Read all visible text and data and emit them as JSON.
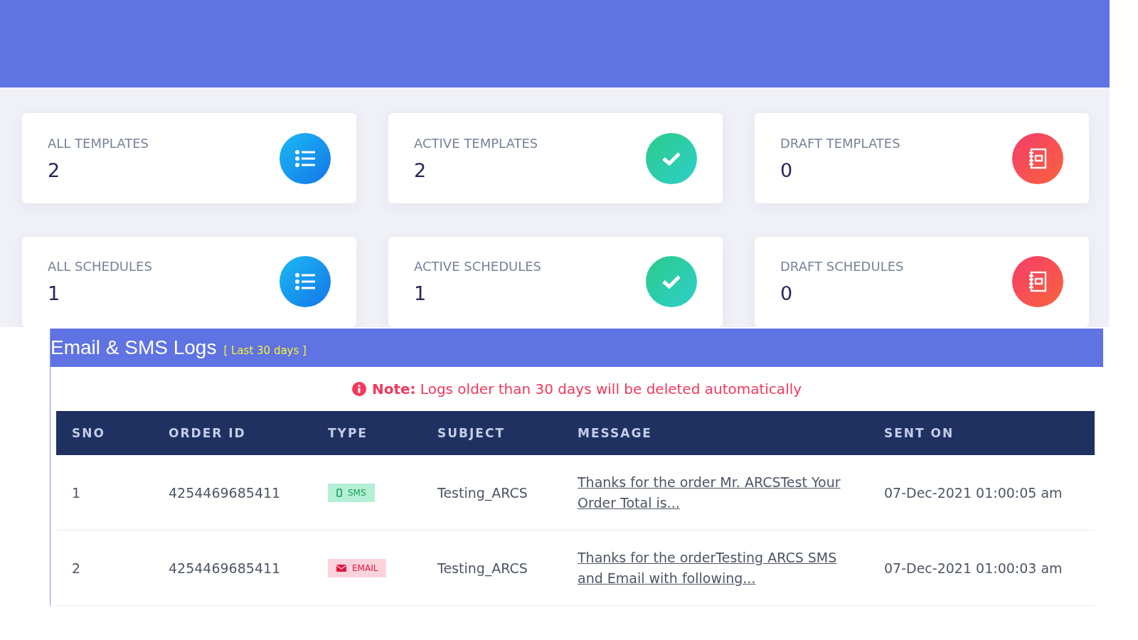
{
  "stats": [
    {
      "label": "ALL TEMPLATES",
      "value": "2",
      "kind": "all"
    },
    {
      "label": "ACTIVE TEMPLATES",
      "value": "2",
      "kind": "active"
    },
    {
      "label": "DRAFT TEMPLATES",
      "value": "0",
      "kind": "draft"
    },
    {
      "label": "ALL SCHEDULES",
      "value": "1",
      "kind": "all"
    },
    {
      "label": "ACTIVE SCHEDULES",
      "value": "1",
      "kind": "active"
    },
    {
      "label": "DRAFT SCHEDULES",
      "value": "0",
      "kind": "draft"
    }
  ],
  "logs": {
    "title": "Email & SMS Logs",
    "range": "[ Last 30 days ]",
    "note": "**Note:** Logs older than 30 days will be deleted automatically",
    "columns": [
      "SNO",
      "ORDER ID",
      "TYPE",
      "SUBJECT",
      "MESSAGE",
      "SENT ON"
    ],
    "rows": [
      {
        "sno": "1",
        "order_id": "4254469685411",
        "type": {
          "kind": "sms",
          "label": "SMS"
        },
        "subject": "Testing_ARCS",
        "message": "Thanks for the order Mr. ARCSTest Your Order Total is...",
        "sent_on": "07-Dec-2021 01:00:05 am"
      },
      {
        "sno": "2",
        "order_id": "4254469685411",
        "type": {
          "kind": "email",
          "label": "EMAIL"
        },
        "subject": "Testing_ARCS",
        "message": "Thanks for the orderTesting ARCS SMS and Email with following...",
        "sent_on": "07-Dec-2021 01:00:03 am"
      }
    ]
  }
}
